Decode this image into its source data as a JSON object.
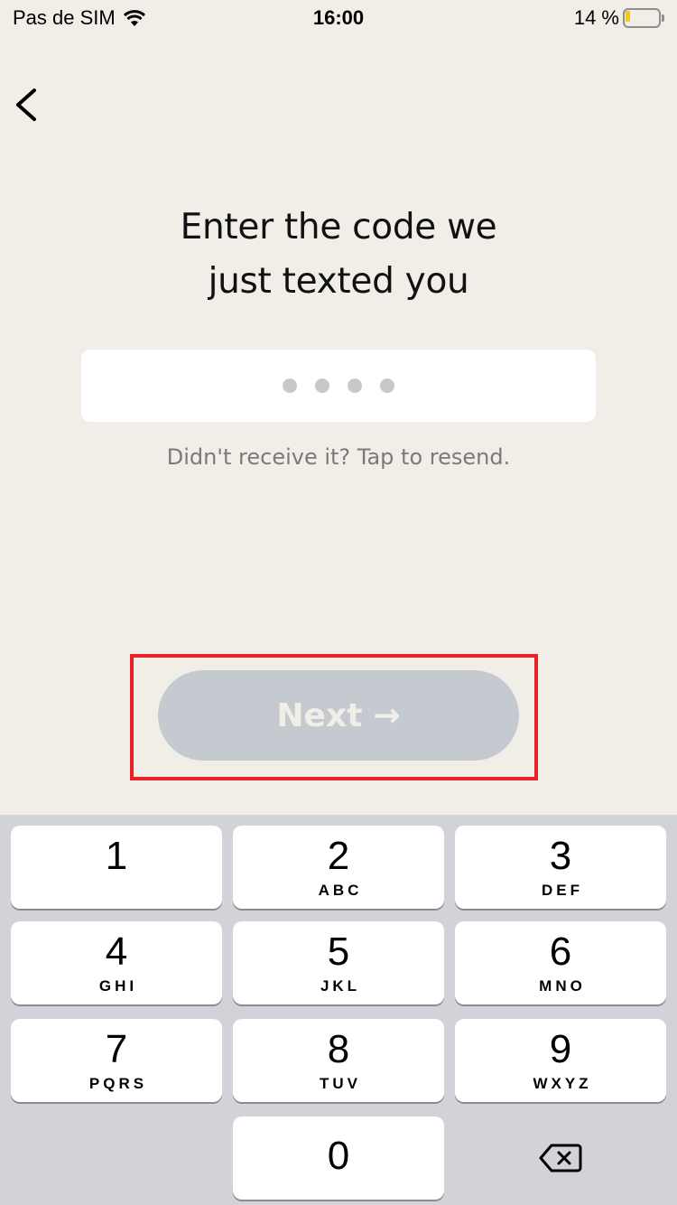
{
  "status_bar": {
    "carrier": "Pas de SIM",
    "wifi_icon": "wifi-icon",
    "time": "16:00",
    "battery_percent_label": "14 %",
    "battery_level": 0.14,
    "battery_color": "#f5c518"
  },
  "nav": {
    "back_icon": "chevron-left-icon"
  },
  "main": {
    "title_line1": "Enter the code we",
    "title_line2": "just texted you",
    "code_field": {
      "value": "",
      "placeholder_dots": 4
    },
    "resend_link": "Didn't receive it? Tap to resend.",
    "next_button": {
      "label": "Next",
      "arrow": "→",
      "enabled": false,
      "color": "#c5cad1"
    },
    "highlight_color": "#e8202a"
  },
  "keypad": {
    "keys": [
      {
        "digit": "1",
        "letters": ""
      },
      {
        "digit": "2",
        "letters": "ABC"
      },
      {
        "digit": "3",
        "letters": "DEF"
      },
      {
        "digit": "4",
        "letters": "GHI"
      },
      {
        "digit": "5",
        "letters": "JKL"
      },
      {
        "digit": "6",
        "letters": "MNO"
      },
      {
        "digit": "7",
        "letters": "PQRS"
      },
      {
        "digit": "8",
        "letters": "TUV"
      },
      {
        "digit": "9",
        "letters": "WXYZ"
      },
      {
        "digit": "0",
        "letters": ""
      }
    ],
    "delete_icon": "backspace-icon"
  }
}
